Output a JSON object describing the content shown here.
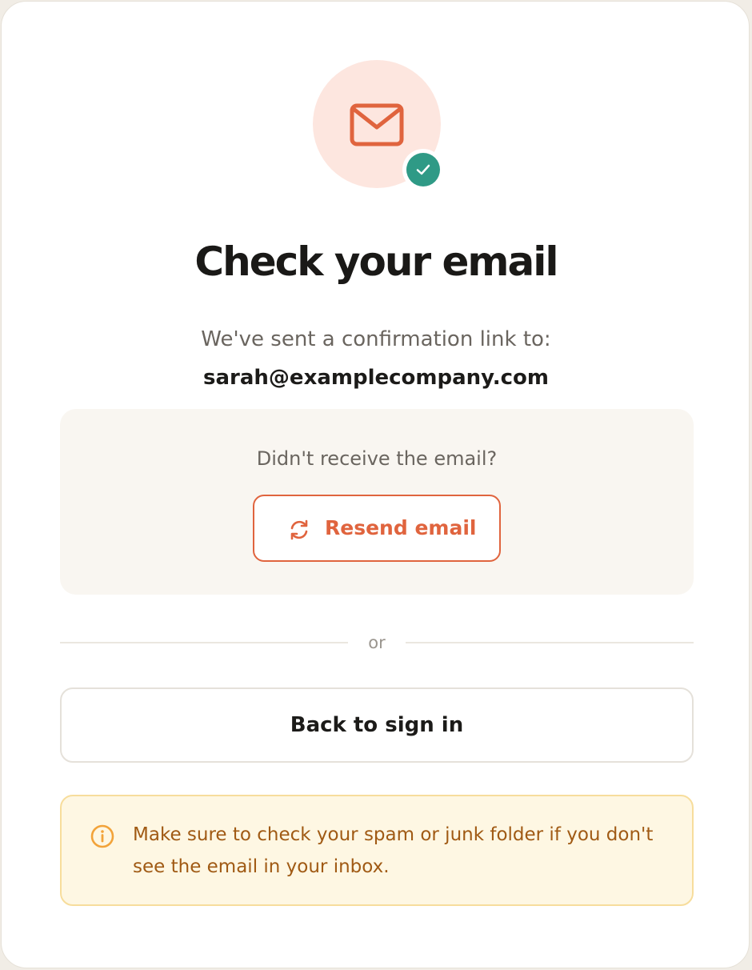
{
  "colors": {
    "accent": "#e0643e",
    "accent_soft": "#fde6df",
    "success": "#2f9a86",
    "notice_text": "#a05a14",
    "notice_bg": "#fef7e3",
    "notice_border": "#f7dd9c"
  },
  "hero": {
    "icon": "envelope-icon",
    "badge_icon": "checkmark-icon"
  },
  "title": "Check your email",
  "subtitle": "We've sent a confirmation link to:",
  "email": "sarah@examplecompany.com",
  "resend": {
    "prompt": "Didn't receive the email?",
    "button_label": "Resend email",
    "button_icon": "refresh-icon"
  },
  "divider_label": "or",
  "back_button_label": "Back to sign in",
  "notice": {
    "icon": "info-icon",
    "text": "Make sure to check your spam or junk folder if you don't see the email in your inbox."
  }
}
